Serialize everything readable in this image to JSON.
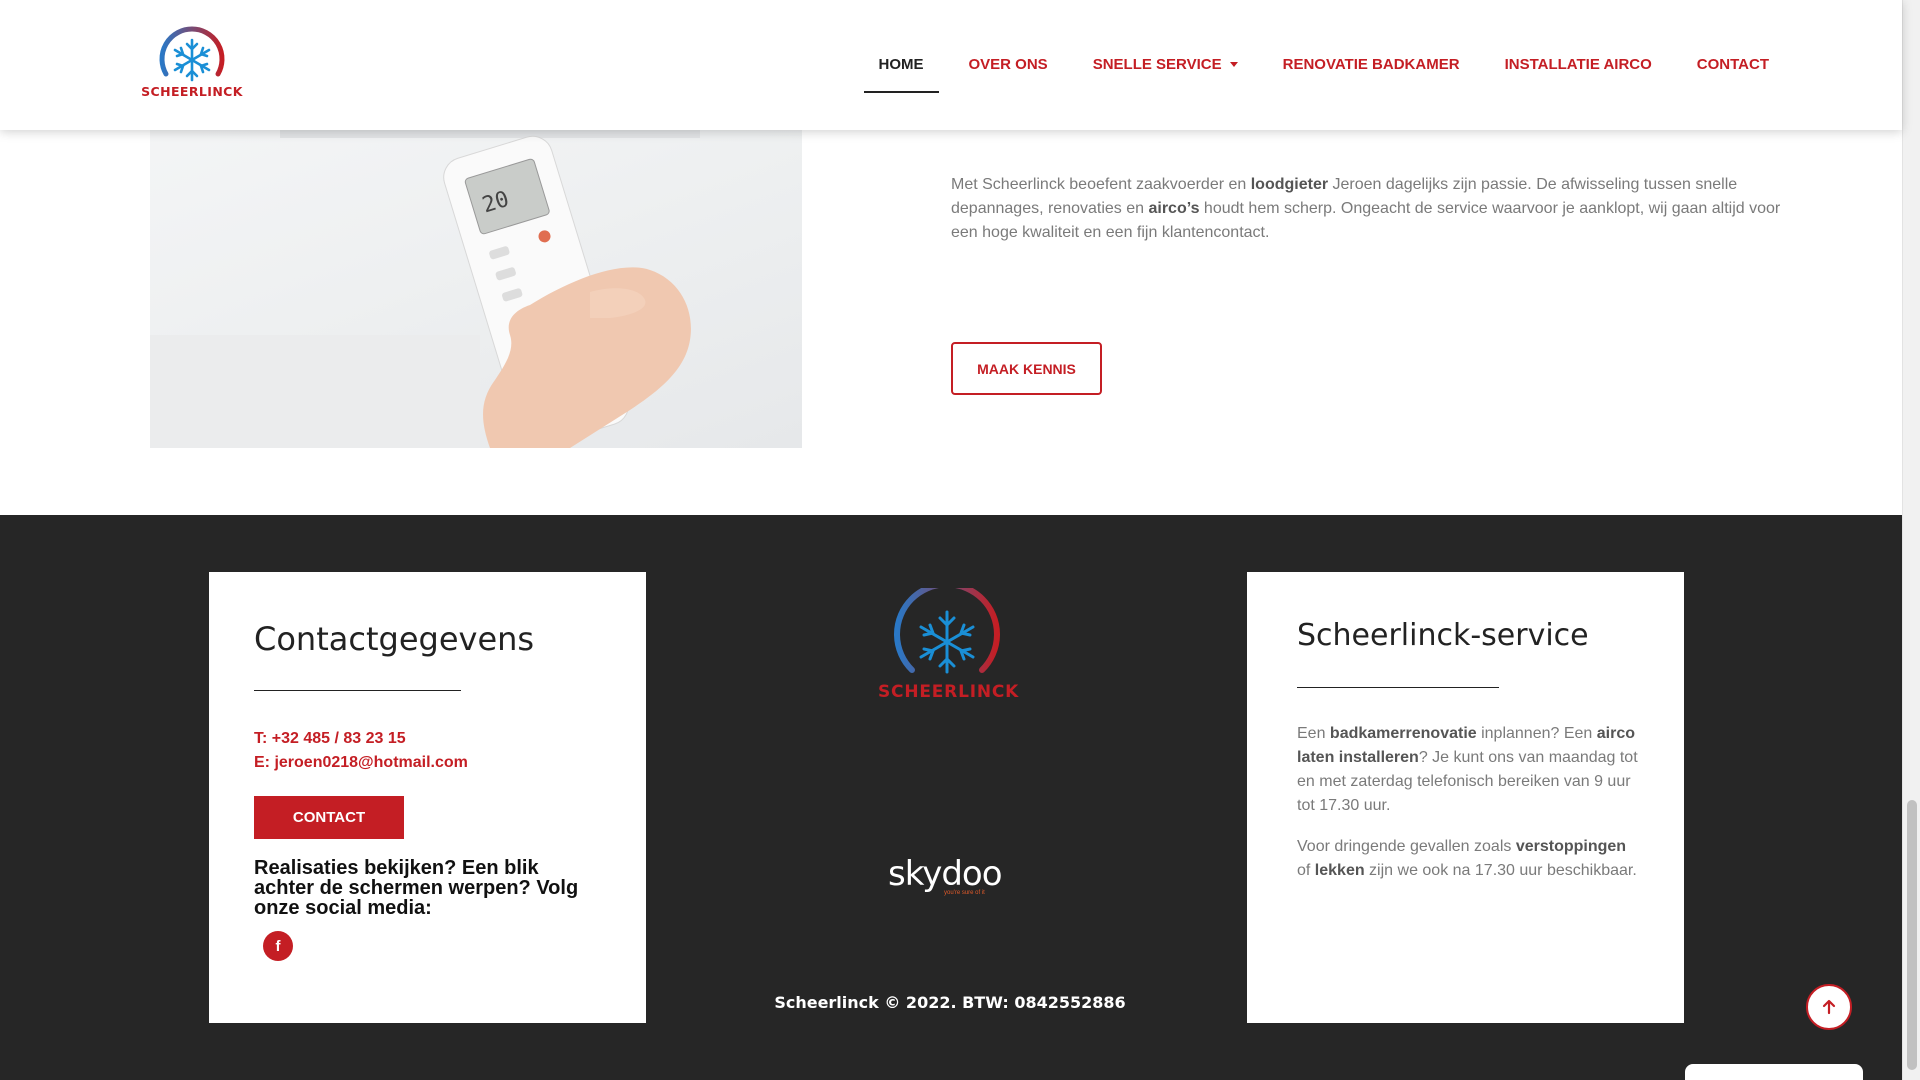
{
  "brand": {
    "name": "SCHEERLINCK",
    "accent": "#c41e24",
    "footer_bg": "#262626"
  },
  "nav": {
    "items": [
      {
        "label": "HOME",
        "active": true
      },
      {
        "label": "OVER ONS"
      },
      {
        "label": "SNELLE SERVICE",
        "dropdown": true
      },
      {
        "label": "RENOVATIE BADKAMER"
      },
      {
        "label": "INSTALLATIE AIRCO"
      },
      {
        "label": "CONTACT"
      }
    ]
  },
  "hero": {
    "image": "hand-holding-airco-remote",
    "remote_display": "20"
  },
  "intro": {
    "p1": "Met Scheerlinck beoefent zaakvoerder en ",
    "b1": "loodgieter",
    "p2": " Jeroen dagelijks zijn passie. De afwisseling tussen snelle depannages, renovaties en ",
    "b2": "airco’s",
    "p3": " houdt hem scherp. Ongeacht de service waarvoor je aanklopt, wij gaan altijd voor een hoge kwaliteit en een fijn klantencontact.",
    "button": "MAAK KENNIS"
  },
  "contact_card": {
    "title": "Contactgegevens",
    "phone": "T: +32 485 / 83 23 15",
    "email": "E: jeroen0218@hotmail.com",
    "button": "CONTACT",
    "social_text": "Realisaties bekijken? Een blik achter de schermen werpen? Volg onze social media:",
    "social_icon": "facebook-icon",
    "facebook_glyph": "f"
  },
  "center": {
    "logo_text": "SCHEERLINCK",
    "partner": "skydoo",
    "partner_tagline": "you're sure of it",
    "copyright": "Scheerlinck © 2022. BTW: 0842552886"
  },
  "service_card": {
    "title": "Scheerlinck-service",
    "p1_a": "Een ",
    "p1_b1": "badkamerrenovatie",
    "p1_c": " inplannen? Een ",
    "p1_b2": "airco laten installeren",
    "p1_d": "? Je kunt ons van maandag tot en met zaterdag telefonisch bereiken van 9 uur tot 17.30 uur.",
    "p2_a": "Voor dringende gevallen zoals ",
    "p2_b1": "verstoppingen",
    "p2_c": " of ",
    "p2_b2": "lekken",
    "p2_d": " zijn we ook na 17.30 uur beschikbaar."
  },
  "widgets": {
    "scroll_top_icon": "arrow-up-icon"
  }
}
